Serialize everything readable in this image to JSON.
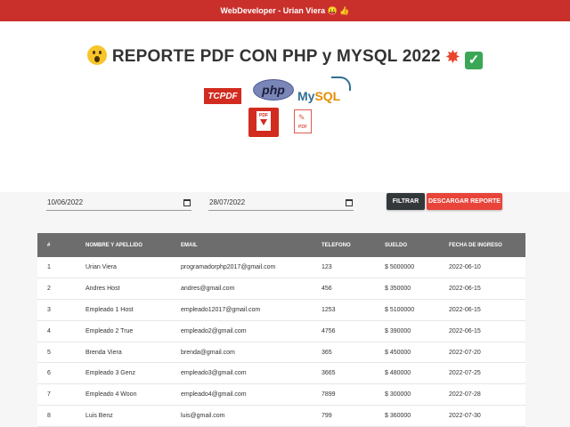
{
  "topbar": {
    "text": "WebDeveloper - Urian Viera 😛 👍"
  },
  "hero": {
    "title": "REPORTE PDF CON PHP y MYSQL 2022",
    "logos": {
      "tcpdf": "TCPDF",
      "php": "php",
      "mysql_my": "My",
      "mysql_sql": "SQL",
      "pdf_label": "PDF"
    },
    "icons": [
      "astonished-face-icon",
      "collision-icon",
      "check-mark-icon"
    ]
  },
  "filters": {
    "date_from": "10/06/2022",
    "date_to": "28/07/2022",
    "filter_label": "FILTRAR",
    "download_label": "DESCARGAR REPORTE"
  },
  "colors": {
    "topbar": "#c9302c",
    "download_button": "#e8443a",
    "filter_button": "#33383b",
    "table_header": "#6d6d6d"
  },
  "table": {
    "headers": [
      "#",
      "NOMBRE Y APELLIDO",
      "EMAIL",
      "TELEFONO",
      "SUELDO",
      "FECHA DE INGRESO"
    ],
    "rows": [
      [
        "1",
        "Urian Viera",
        "programadorphp2017@gmail.com",
        "123",
        "$ 5000000",
        "2022-06-10"
      ],
      [
        "2",
        "Andres Host",
        "andres@gmail.com",
        "456",
        "$ 350000",
        "2022-06-15"
      ],
      [
        "3",
        "Empleado 1 Host",
        "empleado12017@gmail.com",
        "1253",
        "$ 5100000",
        "2022-06-15"
      ],
      [
        "4",
        "Empleado 2 True",
        "empleado2@gmail.com",
        "4756",
        "$ 390000",
        "2022-06-15"
      ],
      [
        "5",
        "Brenda Viera",
        "brenda@gmail.com",
        "365",
        "$ 450000",
        "2022-07-20"
      ],
      [
        "6",
        "Empleado 3 Genz",
        "empleado3@gmail.com",
        "3665",
        "$ 480000",
        "2022-07-25"
      ],
      [
        "7",
        "Empleado 4 Woon",
        "empleado4@gmail.com",
        "7899",
        "$ 300000",
        "2022-07-28"
      ],
      [
        "8",
        "Luis Benz",
        "luis@gmail.com",
        "799",
        "$ 360000",
        "2022-07-30"
      ]
    ]
  }
}
